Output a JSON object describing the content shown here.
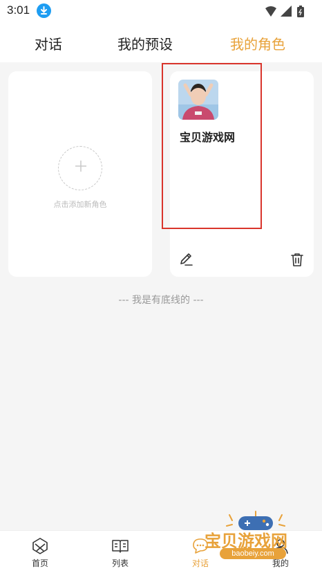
{
  "status_bar": {
    "time": "3:01",
    "icons": [
      "download-icon",
      "wifi-icon",
      "signal-icon",
      "battery-icon"
    ]
  },
  "tabs": [
    {
      "label": "对话",
      "active": false
    },
    {
      "label": "我的预设",
      "active": false
    },
    {
      "label": "我的角色",
      "active": true
    }
  ],
  "add_card": {
    "label": "点击添加新角色"
  },
  "roles": [
    {
      "name": "宝贝游戏网"
    }
  ],
  "footer_text": "--- 我是有底线的 ---",
  "bottom_nav": [
    {
      "label": "首页",
      "icon": "home-icon",
      "active": false
    },
    {
      "label": "列表",
      "icon": "book-icon",
      "active": false
    },
    {
      "label": "对话",
      "icon": "chat-icon",
      "active": true
    },
    {
      "label": "我的",
      "icon": "profile-icon",
      "active": false
    }
  ],
  "watermark": {
    "text": "宝贝游戏网",
    "url": "baobeiy.com"
  },
  "colors": {
    "accent": "#e8a23a",
    "highlight": "#d9342b",
    "background": "#f5f5f5"
  }
}
